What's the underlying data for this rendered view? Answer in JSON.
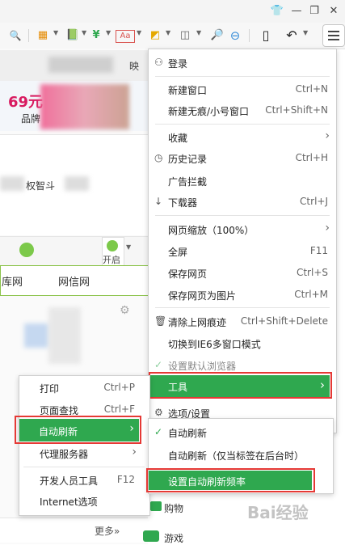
{
  "titlebar": {
    "shirt_icon": "👕",
    "minimize": "—",
    "restore": "❐",
    "close": "✕"
  },
  "toolbar": {
    "search_icon": "🔍",
    "grid_icon": "▦",
    "book_icon": "📗",
    "shield_icon": "¥",
    "translate_icon": "Aa",
    "screenshot_icon": "◩",
    "game_icon": "◫",
    "magnifier_icon": "🔎",
    "zoom_out_icon": "⊖",
    "phone_icon": "▯",
    "undo_icon": "↶",
    "caret": "▼"
  },
  "background_page": {
    "tab_text": "映",
    "promo_price": "69元",
    "promo_sub": "品牌",
    "text_line": "权智斗",
    "open_label": "开启",
    "nav_items": [
      "库网",
      "网信网"
    ],
    "more_link": "更多»",
    "shopping": "购物",
    "games": "游戏"
  },
  "main_menu": {
    "login": "登录",
    "new_window": {
      "label": "新建窗口",
      "shortcut": "Ctrl+N"
    },
    "new_private": {
      "label": "新建无痕/小号窗口",
      "shortcut": "Ctrl+Shift+N"
    },
    "favorites": "收藏",
    "history": {
      "label": "历史记录",
      "shortcut": "Ctrl+H"
    },
    "ad_block": "广告拦截",
    "downloads": {
      "label": "下载器",
      "shortcut": "Ctrl+J"
    },
    "zoom": "网页缩放（100%）",
    "fullscreen": {
      "label": "全屏",
      "shortcut": "F11"
    },
    "save_page": {
      "label": "保存网页",
      "shortcut": "Ctrl+S"
    },
    "save_image": {
      "label": "保存网页为图片",
      "shortcut": "Ctrl+M"
    },
    "clear_traces": {
      "label": "清除上网痕迹",
      "shortcut": "Ctrl+Shift+Delete"
    },
    "ie6_mode": "切换到IE6多窗口模式",
    "default_browser": "设置默认浏览器",
    "tools": "工具",
    "options": "选项/设置"
  },
  "tools_menu": {
    "print": {
      "label": "打印",
      "shortcut": "Ctrl+P"
    },
    "find": {
      "label": "页面查找",
      "shortcut": "Ctrl+F"
    },
    "auto_refresh": "自动刷新",
    "proxy": "代理服务器",
    "devtools": {
      "label": "开发人员工具",
      "shortcut": "F12"
    },
    "internet_options": "Internet选项"
  },
  "refresh_menu": {
    "auto_refresh": "自动刷新",
    "auto_refresh_bg": "自动刷新（仅当标签在后台时）",
    "set_frequency": "设置自动刷新频率"
  },
  "watermark": "Bai经验",
  "colors": {
    "accent_green": "#2fa84f",
    "highlight_red": "#e53935"
  }
}
